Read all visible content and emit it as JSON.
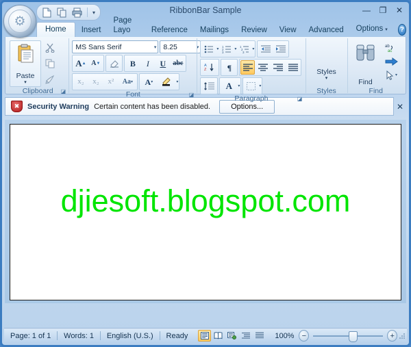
{
  "window": {
    "title": "RibbonBar Sample",
    "minimize_label": "—",
    "maximize_label": "❐",
    "close_label": "✕"
  },
  "office_button": {
    "name": "Office Button",
    "glyph": "⚙"
  },
  "quick_access": {
    "items": [
      {
        "name": "new-document",
        "label": "New"
      },
      {
        "name": "copy",
        "label": "Copy"
      },
      {
        "name": "print",
        "label": "Print"
      }
    ],
    "customize_label": "▾"
  },
  "tabs": [
    {
      "label": "Home",
      "active": true
    },
    {
      "label": "Insert",
      "active": false
    },
    {
      "label": "Page Layo",
      "active": false
    },
    {
      "label": "Reference",
      "active": false
    },
    {
      "label": "Mailings",
      "active": false
    },
    {
      "label": "Review",
      "active": false
    },
    {
      "label": "View",
      "active": false
    },
    {
      "label": "Advanced",
      "active": false
    },
    {
      "label": "Options",
      "active": false
    }
  ],
  "tab_extras": {
    "options_caret": "▾",
    "help_label": "?"
  },
  "ribbon": {
    "clipboard": {
      "label": "Clipboard",
      "paste_label": "Paste",
      "paste_caret": "▾",
      "cut_label": "Cut",
      "copy_label": "Copy",
      "format_painter_label": "Format Painter",
      "launcher": "◪"
    },
    "font": {
      "label": "Font",
      "font_name": "MS Sans Serif",
      "font_size": "8.25",
      "caret": "▾",
      "grow_label": "A",
      "shrink_label": "A",
      "clear_label": "Clear Formatting",
      "bold_label": "B",
      "italic_label": "I",
      "underline_label": "U",
      "strike_label": "abc",
      "subscript_label": "x₂",
      "subscript2_label": "x₂",
      "superscript_label": "x²",
      "changecase_label": "Aa",
      "font_color_label": "A",
      "highlight_label": "Highlight",
      "launcher": "◪"
    },
    "paragraph": {
      "label": "Paragraph",
      "bullets_label": "Bullets",
      "numbering_label": "Numbering",
      "multilevel_label": "Multilevel List",
      "decrease_indent_label": "Decrease Indent",
      "increase_indent_label": "Increase Indent",
      "sort_label": "Sort",
      "marks_label": "¶",
      "align_left_label": "Align Left",
      "align_center_label": "Center",
      "align_right_label": "Align Right",
      "justify_label": "Justify",
      "line_spacing_label": "Line Spacing",
      "shading_label": "A",
      "borders_label": "Borders",
      "caret": "▾",
      "launcher": "◪"
    },
    "styles": {
      "label": "Styles",
      "button_label": "Styles",
      "caret": "▾"
    },
    "find": {
      "label": "Find",
      "find_label": "Find",
      "replace_label": "Replace",
      "goto_label": "Go To",
      "select_label": "Select",
      "caret": "▾"
    }
  },
  "security_bar": {
    "title": "Security Warning",
    "message": "Certain content has been disabled.",
    "options_label": "Options...",
    "close_label": "✕"
  },
  "document": {
    "watermark_text": "djiesoft.blogspot.com",
    "watermark_color": "#00e500"
  },
  "status_bar": {
    "page": "Page: 1 of 1",
    "words": "Words: 1",
    "language": "English (U.S.)",
    "state": "Ready",
    "zoom": "100%",
    "zoom_out_label": "−",
    "zoom_in_label": "+",
    "views": [
      {
        "name": "print-layout",
        "active": true
      },
      {
        "name": "full-screen-reading",
        "active": false
      },
      {
        "name": "web-layout",
        "active": false
      },
      {
        "name": "outline",
        "active": false
      },
      {
        "name": "draft",
        "active": false
      }
    ]
  }
}
